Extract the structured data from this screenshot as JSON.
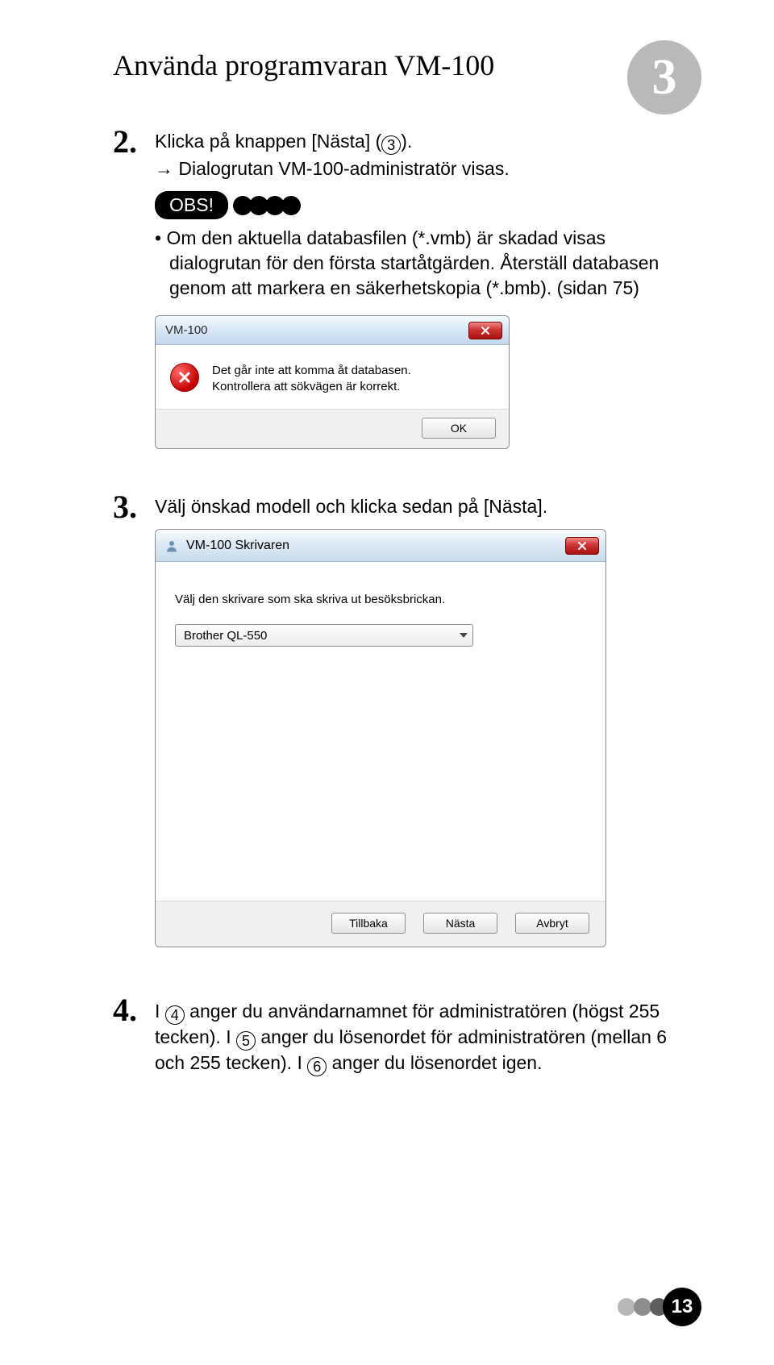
{
  "header": {
    "title": "Använda programvaran VM-100",
    "chapter": "3"
  },
  "step2": {
    "num": "2.",
    "main_pre": "Klicka på knappen [Nästa] (",
    "main_circ": "3",
    "main_post": ").",
    "arrow_line": "Dialogrutan VM-100-administratör visas.",
    "obs_label": "OBS!",
    "bullet1": "Om den aktuella databasfilen (*.vmb) är skadad visas dialogrutan för den första startåtgärden. Återställ databasen genom att markera en säkerhetskopia (*.bmb). (sidan 75)"
  },
  "dialog1": {
    "title": "VM-100",
    "msg_line1": "Det går inte att komma åt databasen.",
    "msg_line2": "Kontrollera att sökvägen är korrekt.",
    "ok": "OK"
  },
  "step3": {
    "num": "3.",
    "main": "Välj önskad modell och klicka sedan på [Nästa]."
  },
  "dialog2": {
    "title": "VM-100 Skrivaren",
    "instruction": "Välj den skrivare som ska skriva ut besöksbrickan.",
    "selected": "Brother QL-550",
    "back": "Tillbaka",
    "next": "Nästa",
    "cancel": "Avbryt"
  },
  "step4": {
    "num": "4.",
    "p1_pre": "I ",
    "p1_c": "4",
    "p1_post": " anger du användarnamnet för administratören (högst 255 tecken). I ",
    "p2_c": "5",
    "p2_post": " anger du lösenordet för administratören (mellan 6 och 255 tecken). I ",
    "p3_c": "6",
    "p3_post": " anger du lösenordet igen."
  },
  "footer": {
    "page": "13"
  }
}
